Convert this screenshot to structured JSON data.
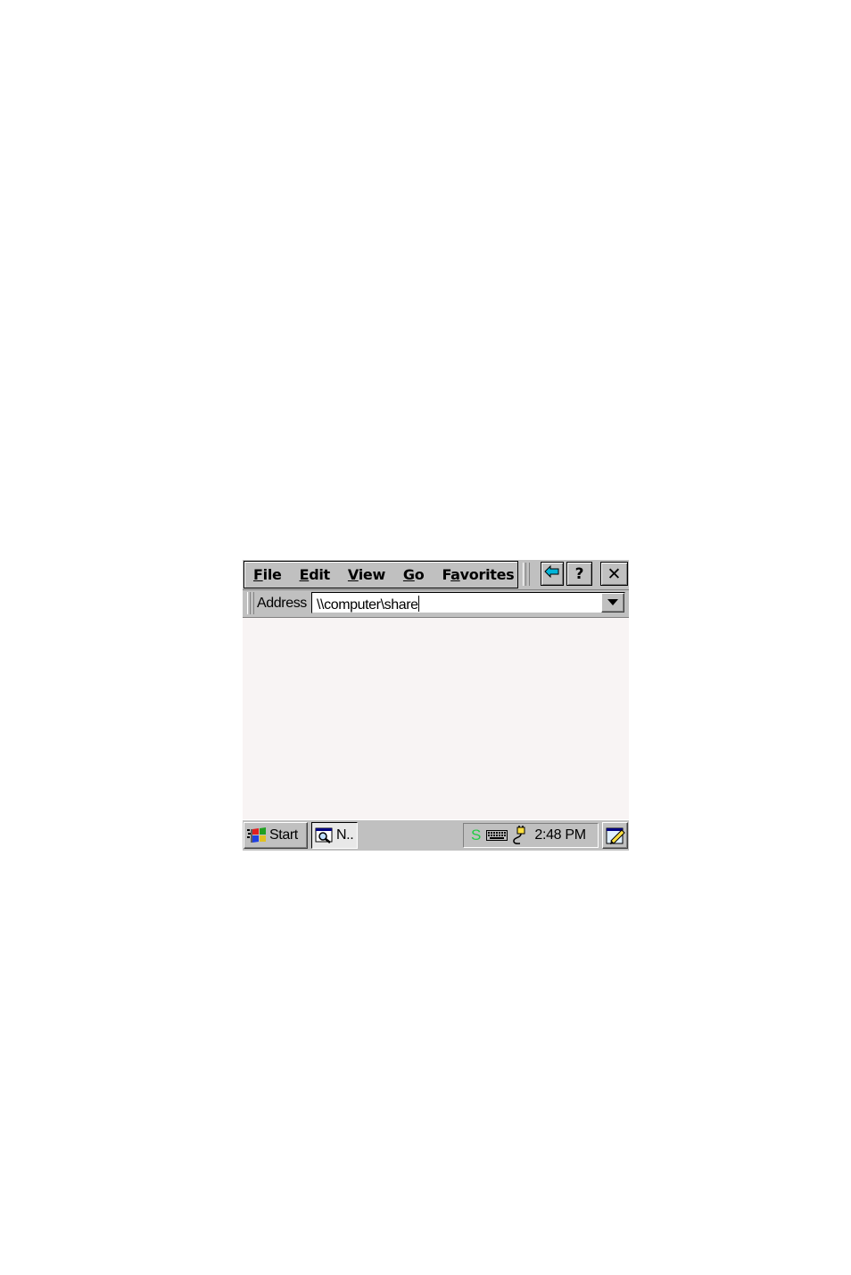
{
  "menubar": {
    "items": [
      {
        "pre": "",
        "key": "F",
        "post": "ile"
      },
      {
        "pre": "",
        "key": "E",
        "post": "dit"
      },
      {
        "pre": "",
        "key": "V",
        "post": "iew"
      },
      {
        "pre": "",
        "key": "G",
        "post": "o"
      },
      {
        "pre": "F",
        "key": "a",
        "post": "vorites"
      }
    ],
    "help_label": "?",
    "close_label": "✕",
    "icons": [
      "back-arrow-icon",
      "help-icon",
      "close-icon"
    ],
    "accent_color": "#00a8c8"
  },
  "address": {
    "label": "Address",
    "value": "\\\\computer\\share"
  },
  "taskbar": {
    "start_label": "Start",
    "task_label": "N..",
    "tray_s": "S",
    "clock": "2:48 PM",
    "icons": [
      "windows-flag-icon",
      "explorer-search-icon",
      "keyboard-icon",
      "power-plug-icon",
      "desktop-pencil-icon"
    ]
  }
}
